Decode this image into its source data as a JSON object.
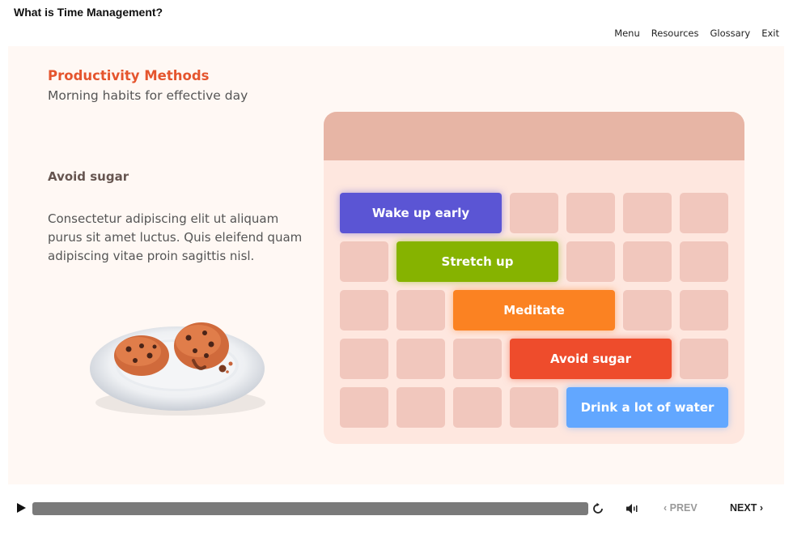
{
  "window": {
    "title": "What is Time Management?"
  },
  "nav": {
    "menu": "Menu",
    "resources": "Resources",
    "glossary": "Glossary",
    "exit": "Exit"
  },
  "slide": {
    "heading": "Productivity Methods",
    "subheading": "Morning habits for effective day",
    "section_title": "Avoid sugar",
    "body": "Consectetur adipiscing elit ut aliquam purus sit amet luctus. Quis eleifend quam adipiscing vitae proin sagittis nisl."
  },
  "schedule": {
    "tasks": [
      {
        "label": "Wake up early",
        "color": "#5b55d4"
      },
      {
        "label": "Stretch up",
        "color": "#86b300"
      },
      {
        "label": "Meditate",
        "color": "#fb8222"
      },
      {
        "label": "Avoid sugar",
        "color": "#ee4c2c"
      },
      {
        "label": "Drink a lot of water",
        "color": "#62a7ff"
      }
    ]
  },
  "player": {
    "prev_label": "PREV",
    "next_label": "NEXT",
    "play_icon": "play-icon",
    "replay_icon": "replay-icon",
    "volume_icon": "volume-icon"
  }
}
